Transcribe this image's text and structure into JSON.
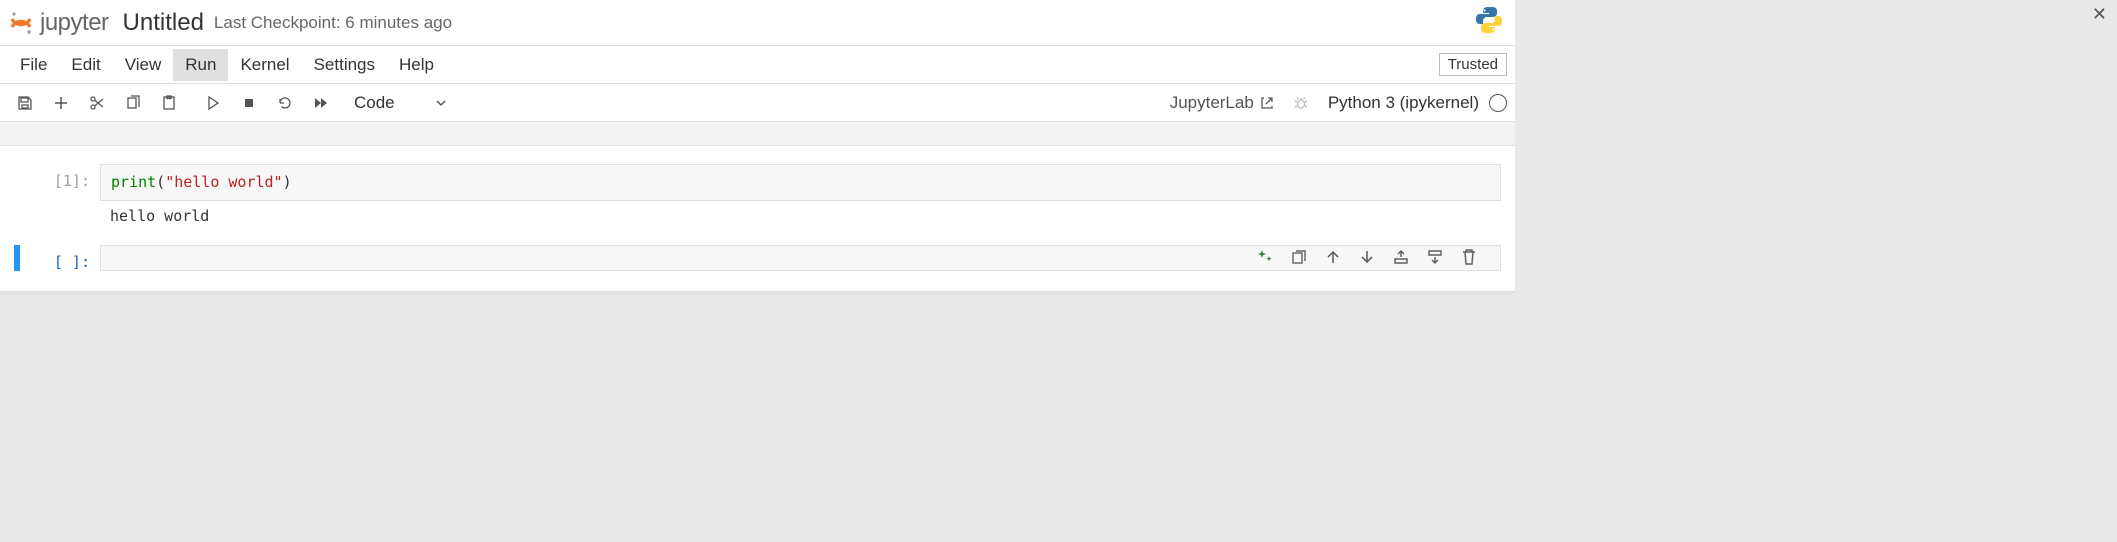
{
  "header": {
    "logo_text": "jupyter",
    "title": "Untitled",
    "checkpoint": "Last Checkpoint: 6 minutes ago"
  },
  "menu": {
    "items": [
      "File",
      "Edit",
      "View",
      "Run",
      "Kernel",
      "Settings",
      "Help"
    ],
    "active_index": 3,
    "trusted_label": "Trusted"
  },
  "toolbar": {
    "cell_type": "Code",
    "jupyterlab_label": "JupyterLab",
    "kernel_label": "Python 3 (ipykernel)"
  },
  "cells": [
    {
      "execution_count": 1,
      "prompt": "[1]:",
      "source_plain": "print(\"hello world\")",
      "source_tokens": [
        {
          "t": "print",
          "cls": "code-keyword"
        },
        {
          "t": "(",
          "cls": "code-punc"
        },
        {
          "t": "\"hello world\"",
          "cls": "code-string"
        },
        {
          "t": ")",
          "cls": "code-punc"
        }
      ],
      "output": "hello world",
      "selected": false
    },
    {
      "execution_count": null,
      "prompt": "[ ]:",
      "source_plain": "",
      "source_tokens": [],
      "output": null,
      "selected": true
    }
  ],
  "cell_toolbar_icons": [
    "ai-sparkle",
    "duplicate",
    "move-up",
    "move-down",
    "insert-above",
    "insert-below",
    "delete"
  ],
  "window": {
    "close_glyph": "✕"
  }
}
